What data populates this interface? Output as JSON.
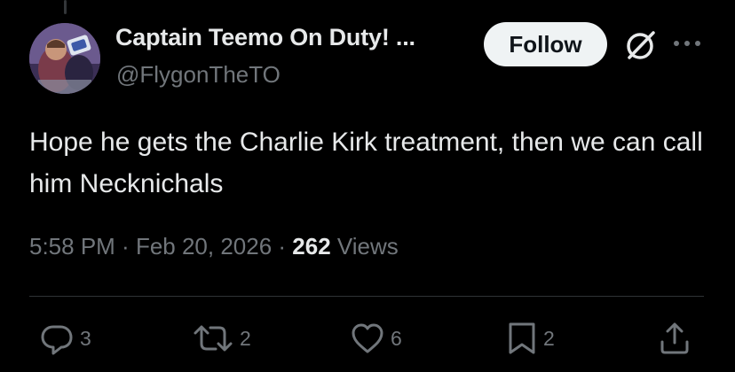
{
  "author": {
    "display_name": "Captain Teemo On Duty! ...",
    "handle": "@FlygonTheTO"
  },
  "header": {
    "follow_label": "Follow",
    "icons": [
      "grok-icon",
      "more-icon"
    ]
  },
  "tweet": {
    "text": "Hope he gets the Charlie Kirk treatment, then we can call him Necknichals"
  },
  "meta": {
    "time": "5:58 PM",
    "sep1": " · ",
    "date": "Feb 20, 2026",
    "sep2": " · ",
    "views_count": "262",
    "views_label": " Views"
  },
  "actions": {
    "replies": "3",
    "retweets": "2",
    "likes": "6",
    "bookmarks": "2",
    "icons": [
      "reply-icon",
      "retweet-icon",
      "like-icon",
      "bookmark-icon",
      "share-icon"
    ]
  },
  "colors": {
    "background": "#000000",
    "primary_text": "#e7e9ea",
    "secondary_text": "#71767b",
    "follow_bg": "#eff3f4",
    "divider": "#2f3336"
  }
}
